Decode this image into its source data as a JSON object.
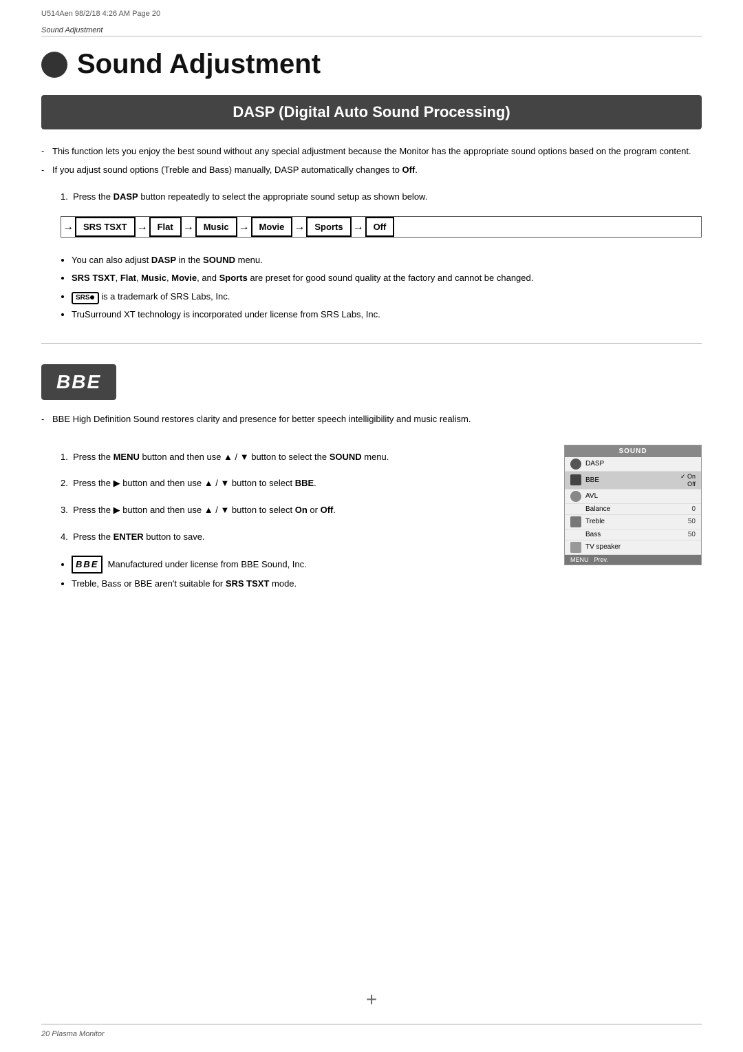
{
  "meta": {
    "top_line": "U514Aen  98/2/18  4:26 AM   Page  20"
  },
  "breadcrumb": "Sound Adjustment",
  "page_title": "Sound Adjustment",
  "dasp_banner": "DASP (Digital Auto Sound Processing)",
  "dasp_bullets": [
    "This function lets you enjoy the best sound without any special adjustment because the Monitor has the appropriate sound options based on the program content.",
    "If you adjust sound options (Treble and Bass) manually, DASP automatically changes to Off."
  ],
  "step1_text": "1.  Press the DASP button repeatedly to select the appropriate sound setup as shown below.",
  "flow_items": [
    "SRS TSXT",
    "Flat",
    "Music",
    "Movie",
    "Sports",
    "Off"
  ],
  "dasp_sub_bullets": [
    "You can also adjust DASP in the SOUND menu.",
    "SRS TSXT, Flat, Music, Movie, and Sports are preset for good sound quality at the factory and cannot be changed.",
    "SRS(circle) is a trademark of SRS Labs, Inc.",
    "TruSurround XT technology is incorporated under license from SRS Labs, Inc."
  ],
  "bbe_banner": "BBE",
  "bbe_bullets": [
    "BBE High Definition Sound restores clarity and presence for better speech intelligibility and music realism."
  ],
  "bbe_steps": [
    "Press the MENU button and then use ▲ / ▼ button to select the SOUND menu.",
    "Press the ▶ button and then use ▲ / ▼ button to select BBE.",
    "Press the ▶ button and then use ▲ / ▼ button to select On or Off.",
    "Press the ENTER button to save."
  ],
  "bbe_sub_bullets": [
    "Manufactured under license from BBE Sound, Inc.",
    "Treble, Bass or BBE aren't suitable for SRS TSXT mode."
  ],
  "menu_mockup": {
    "header": "SOUND",
    "rows": [
      {
        "icon": true,
        "label": "DASP",
        "value": "",
        "highlighted": false
      },
      {
        "icon": true,
        "label": "BBE",
        "value": "▶",
        "highlighted": true,
        "check": "✓ On"
      },
      {
        "icon": false,
        "label": "",
        "value": "",
        "off": "Off",
        "highlighted": false
      },
      {
        "icon": true,
        "label": "AVL",
        "value": "",
        "highlighted": false
      },
      {
        "icon": false,
        "label": "Balance",
        "value": "0",
        "highlighted": false
      },
      {
        "icon": true,
        "label": "Treble",
        "value": "50",
        "highlighted": false
      },
      {
        "icon": false,
        "label": "Bass",
        "value": "50",
        "highlighted": false
      },
      {
        "icon": false,
        "label": "TV speaker",
        "value": "",
        "highlighted": false
      }
    ],
    "footer": [
      "MENU",
      "Prev."
    ]
  },
  "footer": {
    "page_label": "20  Plasma Monitor"
  }
}
